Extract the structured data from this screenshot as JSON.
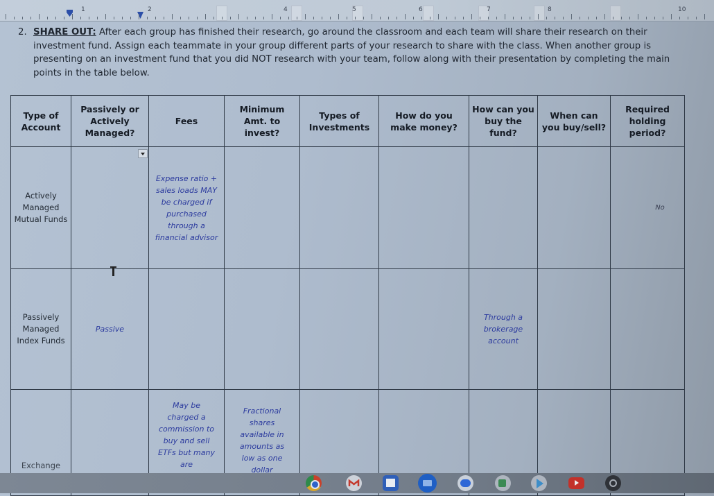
{
  "ruler": {
    "labels": [
      "1",
      "2",
      "4",
      "5",
      "6",
      "7",
      "8",
      "10"
    ]
  },
  "instructions": {
    "number": "2.",
    "heading": "SHARE OUT:",
    "body": " After each group has finished their research, go around the classroom and each team will share their research on their investment fund. Assign each teammate in your group different parts of your research to share with the class. When another group is presenting on an investment fund that you did NOT research with your team, follow along with their presentation by completing the main points in the table below."
  },
  "table": {
    "headers": [
      "Type of Account",
      "Passively or Actively Managed?",
      "Fees",
      "Minimum Amt. to invest?",
      "Types of Investments",
      "How do you make money?",
      "How can you buy the fund?",
      "When can you buy/sell?",
      "Required holding period?"
    ],
    "rows": [
      {
        "type": "Actively Managed Mutual Funds",
        "managed": "",
        "fees": "Expense ratio + sales loads MAY be charged if purchased through a financial advisor",
        "minimum": "",
        "investments": "",
        "make_money": "",
        "how_buy": "",
        "when_buy_sell": "",
        "holding_period": "No"
      },
      {
        "type": "Passively Managed Index Funds",
        "managed": "Passive",
        "fees": "",
        "minimum": "",
        "investments": "",
        "make_money": "",
        "how_buy": "Through a brokerage account",
        "when_buy_sell": "",
        "holding_period": ""
      },
      {
        "type": "Exchange Traded Funds (ETFs)",
        "managed": "",
        "fees": "May be charged a commission to buy and sell ETFs but many are",
        "minimum": "Fractional shares available in amounts as low as one dollar",
        "investments": "",
        "make_money": "",
        "how_buy": "",
        "when_buy_sell": "",
        "holding_period": ""
      }
    ]
  },
  "taskbar": {
    "apps": [
      {
        "name": "Chrome",
        "icon": "chrome-icon",
        "color": "#d9532b"
      },
      {
        "name": "Gmail",
        "icon": "gmail-icon",
        "color": "#c9ced6"
      },
      {
        "name": "Calendar",
        "icon": "calendar-icon",
        "color": "#3b6fd0"
      },
      {
        "name": "Files",
        "icon": "files-icon",
        "color": "#1e63c9"
      },
      {
        "name": "Messages",
        "icon": "messages-icon",
        "color": "#2f6fe0"
      },
      {
        "name": "Meet",
        "icon": "meet-icon",
        "color": "#2d8a55"
      },
      {
        "name": "Play Store",
        "icon": "play-store-icon",
        "color": "#4aa3d8"
      },
      {
        "name": "YouTube",
        "icon": "youtube-icon",
        "color": "#c8302a"
      },
      {
        "name": "Settings",
        "icon": "settings-icon",
        "color": "#3b3f46"
      }
    ]
  }
}
